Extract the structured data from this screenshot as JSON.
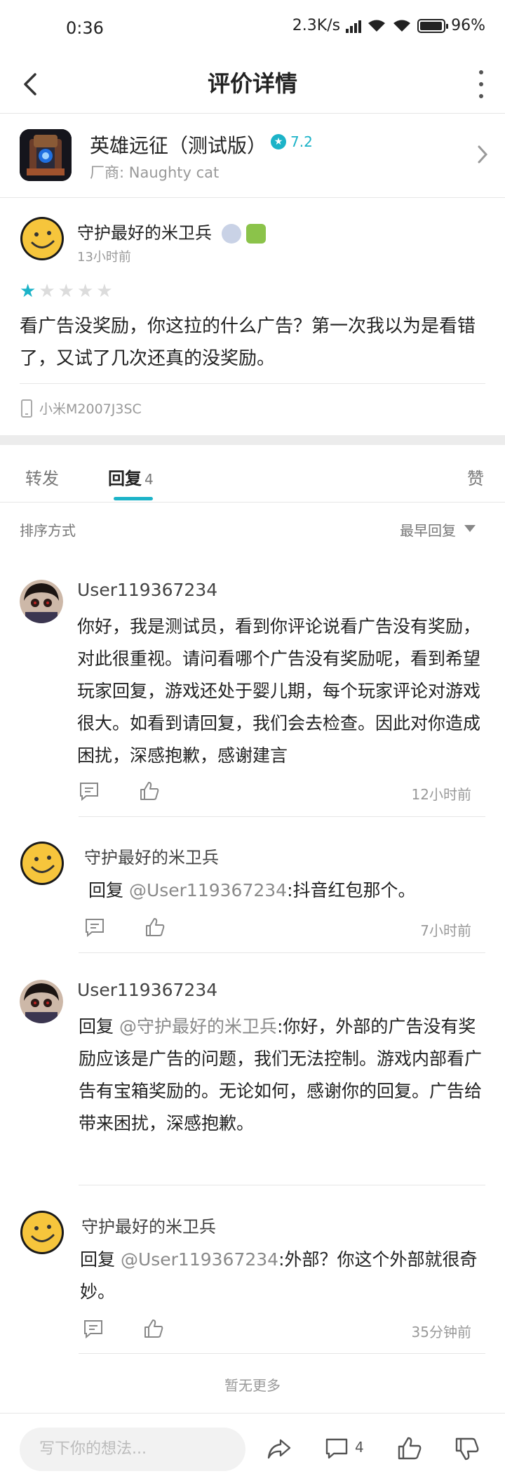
{
  "status_bar": {
    "time": "0:36",
    "network_speed": "2.3K/s",
    "battery": "96",
    "battery_level_percent": 96
  },
  "header": {
    "title": "评价详情"
  },
  "game": {
    "name": "英雄远征（测试版）",
    "rating": "7.2",
    "vendor": "厂商: Naughty cat"
  },
  "review": {
    "author": "守护最好的米卫兵",
    "time": "13小时前",
    "stars_filled": 1,
    "stars_total": 5,
    "body": "看广告没奖励，你这拉的什么广告？第一次我以为是看错了，又试了几次还真的没奖励。",
    "device": "小米M2007J3SC"
  },
  "tabs": [
    {
      "label": "转发"
    },
    {
      "label": "回复",
      "count": "4"
    },
    {
      "label": "赞"
    }
  ],
  "sort": {
    "label": "排序方式",
    "value": "最早回复"
  },
  "replies": [
    {
      "author": "User119367234",
      "prefix": "",
      "mention": "",
      "text": "你好，我是测试员，看到你评论说看广告没有奖励，对此很重视。请问看哪个广告没有奖励呢，看到希望玩家回复，游戏还处于婴儿期，每个玩家评论对游戏很大。如看到请回复，我们会去检查。因此对你造成困扰，深感抱歉，感谢建言",
      "time": "12小时前"
    },
    {
      "author": "守护最好的米卫兵",
      "prefix": "回复 ",
      "mention": "@User119367234",
      "text": ":抖音红包那个。",
      "time": "7小时前"
    },
    {
      "author": "User119367234",
      "prefix": "回复 ",
      "mention": "@守护最好的米卫兵",
      "text": ":你好，外部的广告没有奖励应该是广告的问题，我们无法控制。游戏内部看广告有宝箱奖励的。无论如何，感谢你的回复。广告给带来困扰，深感抱歉。",
      "time": ""
    },
    {
      "author": "守护最好的米卫兵",
      "prefix": "回复 ",
      "mention": "@User119367234",
      "text": ":外部？你这个外部就很奇妙。",
      "time": "35分钟前"
    }
  ],
  "footer": {
    "no_more": "暂无更多",
    "input_placeholder": "写下你的想法...",
    "comment_count": "4"
  },
  "colors": {
    "accent": "#1cb3c8",
    "star_empty": "#dcdcdc"
  }
}
